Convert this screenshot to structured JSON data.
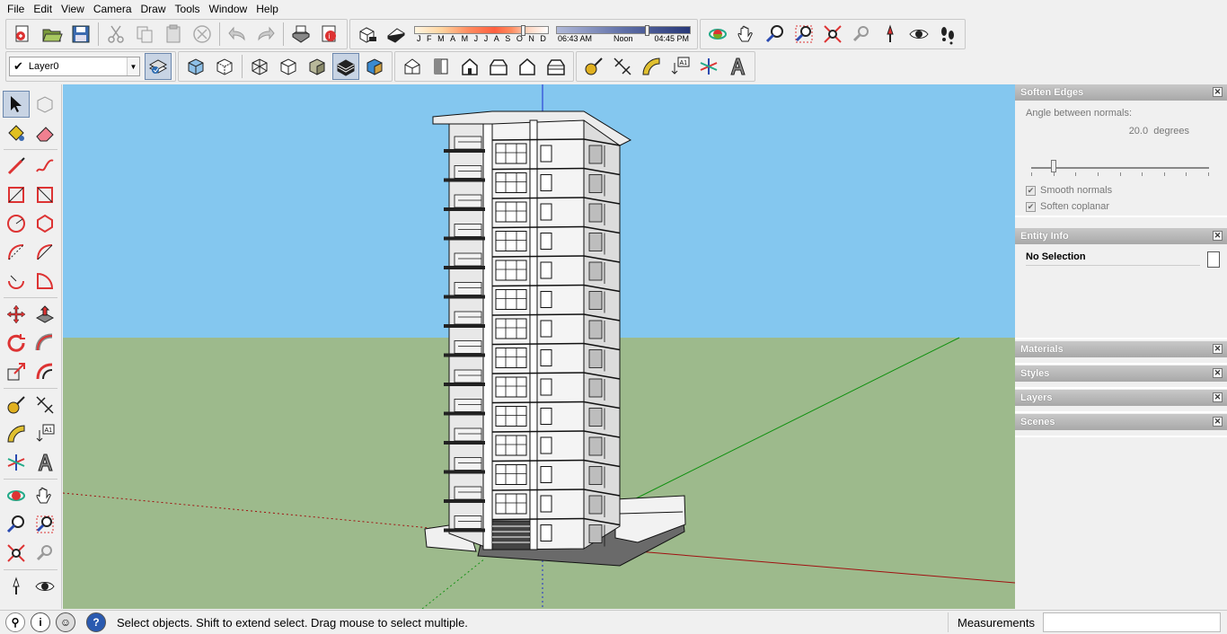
{
  "menu": [
    "File",
    "Edit",
    "View",
    "Camera",
    "Draw",
    "Tools",
    "Window",
    "Help"
  ],
  "shadow": {
    "months": [
      "J",
      "F",
      "M",
      "A",
      "M",
      "J",
      "J",
      "A",
      "S",
      "O",
      "N",
      "D"
    ],
    "time_start": "06:43 AM",
    "time_mid": "Noon",
    "time_end": "04:45 PM"
  },
  "layer": {
    "current": "Layer0"
  },
  "tray": {
    "soften_edges": {
      "title": "Soften Edges",
      "angle_label": "Angle between normals:",
      "angle_value": "20.0",
      "angle_unit": "degrees",
      "smooth_normals": "Smooth normals",
      "soften_coplanar": "Soften coplanar"
    },
    "entity_info": {
      "title": "Entity Info",
      "selection": "No Selection"
    },
    "materials": "Materials",
    "styles": "Styles",
    "layers": "Layers",
    "scenes": "Scenes"
  },
  "status": {
    "message": "Select objects. Shift to extend select. Drag mouse to select multiple.",
    "measurements_label": "Measurements",
    "measurements_value": ""
  },
  "colors": {
    "sky": "#84c7ef",
    "ground": "#9dba8c",
    "accent": "#c8d4e4"
  }
}
